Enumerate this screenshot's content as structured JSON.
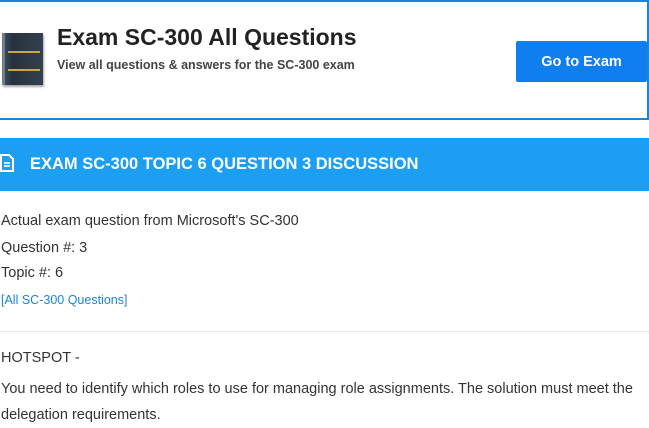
{
  "header": {
    "title": "Exam SC-300 All Questions",
    "subtitle": "View all questions & answers for the SC-300 exam",
    "button_label": "Go to Exam",
    "accent_color": "#1a85d8",
    "button_color": "#0f7ff0"
  },
  "banner": {
    "icon": "document-icon",
    "title": "EXAM SC-300 TOPIC 6 QUESTION 3 DISCUSSION",
    "color": "#1c9ef2"
  },
  "details": {
    "intro": "Actual exam question from Microsoft's SC-300",
    "question_number": "Question #: 3",
    "topic": "Topic #: 6",
    "all_questions_link": "[All SC-300 Questions]"
  },
  "question": {
    "label": "HOTSPOT -",
    "text": "You need to identify which roles to use for managing role assignments. The solution must meet the delegation requirements."
  }
}
